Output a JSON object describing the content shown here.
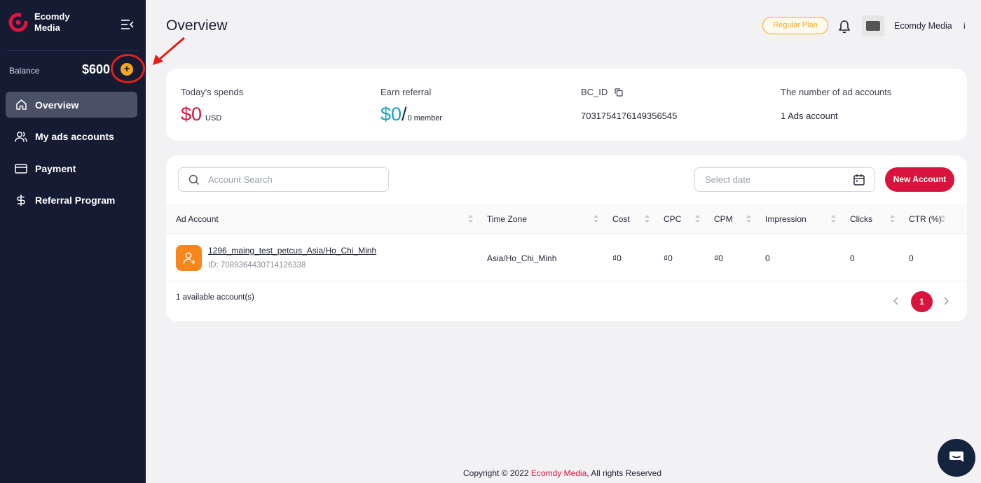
{
  "sidebar": {
    "brand": "Ecomdy\nMedia",
    "balance_label": "Balance",
    "balance_value": "$600",
    "add_symbol": "+",
    "items": [
      {
        "label": "Overview",
        "icon": "home-icon",
        "active": true
      },
      {
        "label": "My ads accounts",
        "icon": "users-icon",
        "active": false
      },
      {
        "label": "Payment",
        "icon": "credit-card-icon",
        "active": false
      },
      {
        "label": "Referral Program",
        "icon": "dollar-icon",
        "active": false
      }
    ]
  },
  "header": {
    "title": "Overview",
    "plan": "Regular Plan",
    "user_name": "Ecomdy Media",
    "more": "i"
  },
  "stats": {
    "spends_label": "Today's spends",
    "spends_value": "$0",
    "spends_unit": "USD",
    "referral_label": "Earn referral",
    "referral_value": "$0",
    "referral_slash": "/",
    "referral_unit": "0 member",
    "bc_label": "BC_ID",
    "bc_value": "7031754176149356545",
    "accounts_label": "The number of ad accounts",
    "accounts_value": "1 Ads account"
  },
  "table": {
    "search_placeholder": "Account Search",
    "date_placeholder": "Select date",
    "new_button": "New Account",
    "columns": [
      "Ad Account",
      "Time Zone",
      "Cost",
      "CPC",
      "CPM",
      "Impression",
      "Clicks",
      "CTR (%)"
    ],
    "rows": [
      {
        "name": "1296_maing_test_petcus_Asia/Ho_Chi_Minh",
        "id": "ID: 7089364430714126338",
        "timezone": "Asia/Ho_Chi_Minh",
        "cost": "₫0",
        "cpc": "₫0",
        "cpm": "₫0",
        "impression": "0",
        "clicks": "0",
        "ctr": "0"
      }
    ],
    "available": "1 available account(s)",
    "current_page": "1"
  },
  "footer": {
    "prefix": "Copyright © 2022",
    "brand": "Ecomdy Media",
    "suffix": ", All rights Reserved"
  },
  "colors": {
    "sidebar_bg": "#141b33",
    "accent": "#d8143d",
    "referral": "#17a2b8",
    "plan": "#f5a623"
  }
}
